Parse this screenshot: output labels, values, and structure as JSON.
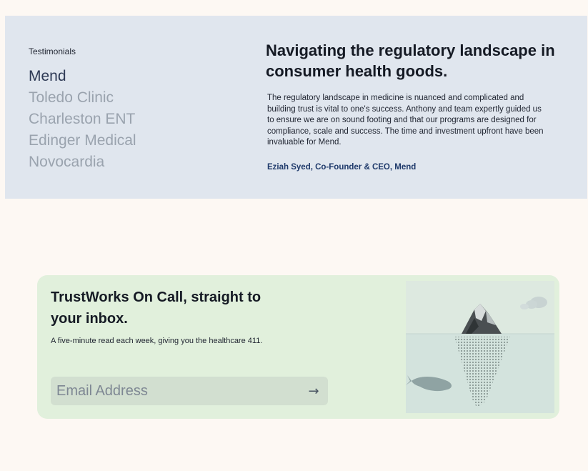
{
  "testimonials": {
    "eyebrow": "Testimonials",
    "items": [
      {
        "label": "Mend",
        "active": true
      },
      {
        "label": "Toledo Clinic"
      },
      {
        "label": "Charleston ENT"
      },
      {
        "label": "Edinger Medical"
      },
      {
        "label": "Novocardia"
      }
    ],
    "heading": "Navigating the regulatory landscape in consumer health goods.",
    "quote": "The regulatory landscape in medicine is nuanced and complicated and building trust is vital to one's success. Anthony and team expertly guided us to ensure we are on sound footing and that our programs are designed for compliance, scale and success. The time and investment upfront have been invaluable for Mend.",
    "author": "Eziah Syed, Co-Founder & CEO, Mend"
  },
  "newsletter": {
    "title": "TrustWorks On Call, straight to your inbox.",
    "subtitle": "A five-minute read each week, giving you the healthcare 411.",
    "email_placeholder": "Email Address",
    "submit_icon": "→",
    "illustration_icon": "iceberg-illustration"
  },
  "colors": {
    "page_bg": "#fdf8f3",
    "testimonials_bg": "#e0e6ee",
    "newsletter_bg": "#e1f0dc",
    "active_item": "#2e3a55",
    "inactive_item": "#9aa3ae",
    "author": "#1f3a6b"
  }
}
